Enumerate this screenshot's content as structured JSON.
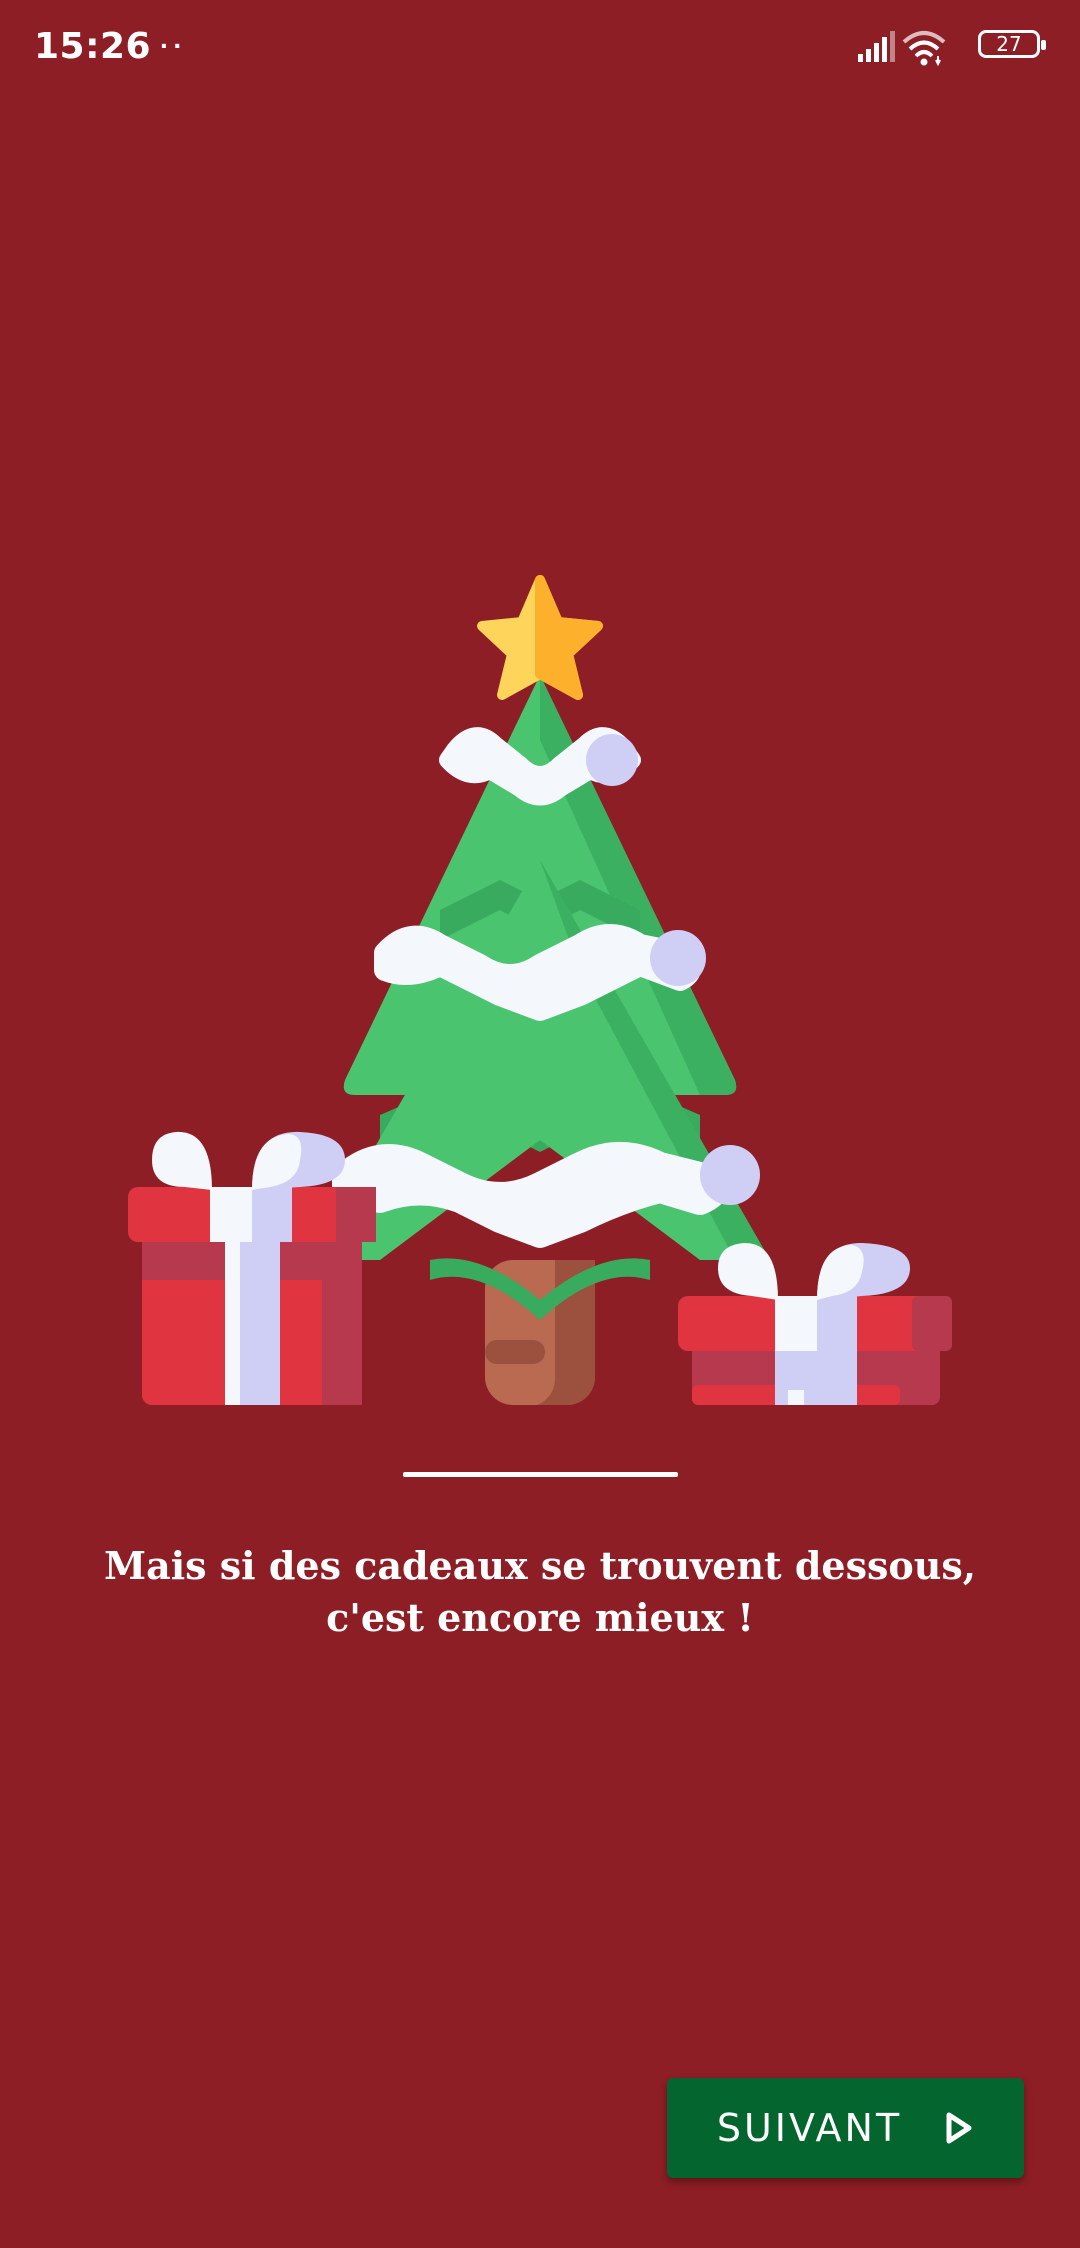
{
  "status_bar": {
    "time": "15:26",
    "notifications": "··",
    "battery_level": "27"
  },
  "illustration": {
    "subject": "christmas-tree-with-presents"
  },
  "caption": {
    "line1": "Mais si des cadeaux se trouvent dessous,",
    "line2": "c'est encore mieux !"
  },
  "next_button": {
    "label": "SUIVANT",
    "icon": "play-outline-icon"
  },
  "colors": {
    "background": "#8e1e25",
    "button": "#05652f",
    "tree_green": "#4bc46f",
    "tree_dark": "#38ab5e",
    "star": "#ffd45b",
    "gift_red": "#e03540",
    "ribbon": "#cfcef5"
  }
}
